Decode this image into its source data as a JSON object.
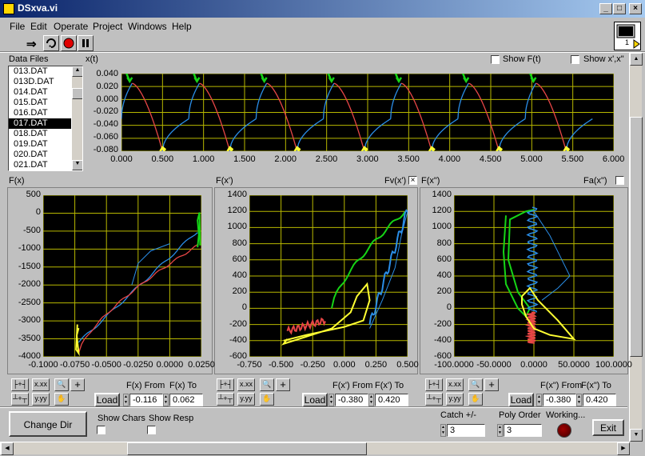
{
  "window": {
    "title": "DSxva.vi"
  },
  "menu": [
    "File",
    "Edit",
    "Operate",
    "Project",
    "Windows",
    "Help"
  ],
  "toolbar": {
    "icon_panel_label": "1"
  },
  "data_files": {
    "label": "Data Files",
    "items": [
      "013.DAT",
      "013D.DAT",
      "014.DAT",
      "015.DAT",
      "016.DAT",
      "017.DAT",
      "018.DAT",
      "019.DAT",
      "020.DAT",
      "021.DAT"
    ],
    "selected": "017.DAT"
  },
  "top_plot": {
    "ylabel": "x(t)",
    "show_ft": "Show F(t)",
    "show_xx": "Show x',x\"",
    "yticks": [
      "0.040",
      "0.020",
      "0.000",
      "-0.020",
      "-0.040",
      "-0.060",
      "-0.080"
    ],
    "xticks": [
      "0.000",
      "0.500",
      "1.000",
      "1.500",
      "2.000",
      "2.500",
      "3.000",
      "3.500",
      "4.000",
      "4.500",
      "5.000",
      "5.500",
      "6.000"
    ]
  },
  "plot1": {
    "ylabel": "F(x)",
    "yticks": [
      "500",
      "0",
      "-500",
      "-1000",
      "-1500",
      "-2000",
      "-2500",
      "-3000",
      "-3500",
      "-4000"
    ],
    "xticks": [
      "-0.1000",
      "-0.0750",
      "-0.0500",
      "-0.0250",
      "0.0000",
      "0.0250"
    ],
    "from_label": "F(x) From",
    "to_label": "F(x) To",
    "from_value": "-0.116",
    "to_value": "0.062",
    "load": "Load"
  },
  "plot2": {
    "ylabel": "F(x')",
    "fv_label": "Fv(x')",
    "yticks": [
      "1400",
      "1200",
      "1000",
      "800",
      "600",
      "400",
      "200",
      "0",
      "-200",
      "-400",
      "-600"
    ],
    "xticks": [
      "-0.750",
      "-0.500",
      "-0.250",
      "0.000",
      "0.250",
      "0.500"
    ],
    "from_label": "F(x') From",
    "to_label": "F(x') To",
    "from_value": "-0.380",
    "to_value": "0.420",
    "load": "Load"
  },
  "plot3": {
    "ylabel": "F(x\")",
    "fa_label": "Fa(x\")",
    "yticks": [
      "1400",
      "1200",
      "1000",
      "800",
      "600",
      "400",
      "200",
      "0",
      "-200",
      "-400",
      "-600"
    ],
    "xticks": [
      "-100.0000",
      "-50.0000",
      "0.0000",
      "50.0000",
      "100.0000"
    ],
    "from_label": "F(x\") From",
    "to_label": "F(x\") To",
    "from_value": "-0.380",
    "to_value": "0.420",
    "load": "Load"
  },
  "bottom": {
    "change_dir": "Change Dir",
    "show_chars": "Show Chars",
    "show_resp": "Show Resp",
    "catch_label": "Catch +/-",
    "catch_value": "3",
    "poly_label": "Poly Order",
    "poly_value": "3",
    "working_label": "Working...",
    "exit": "Exit"
  },
  "colors": {
    "blue": "#2a8ee8",
    "red": "#e84646",
    "green": "#16d416",
    "yellow": "#ffff33",
    "grid": "#b8b800"
  }
}
